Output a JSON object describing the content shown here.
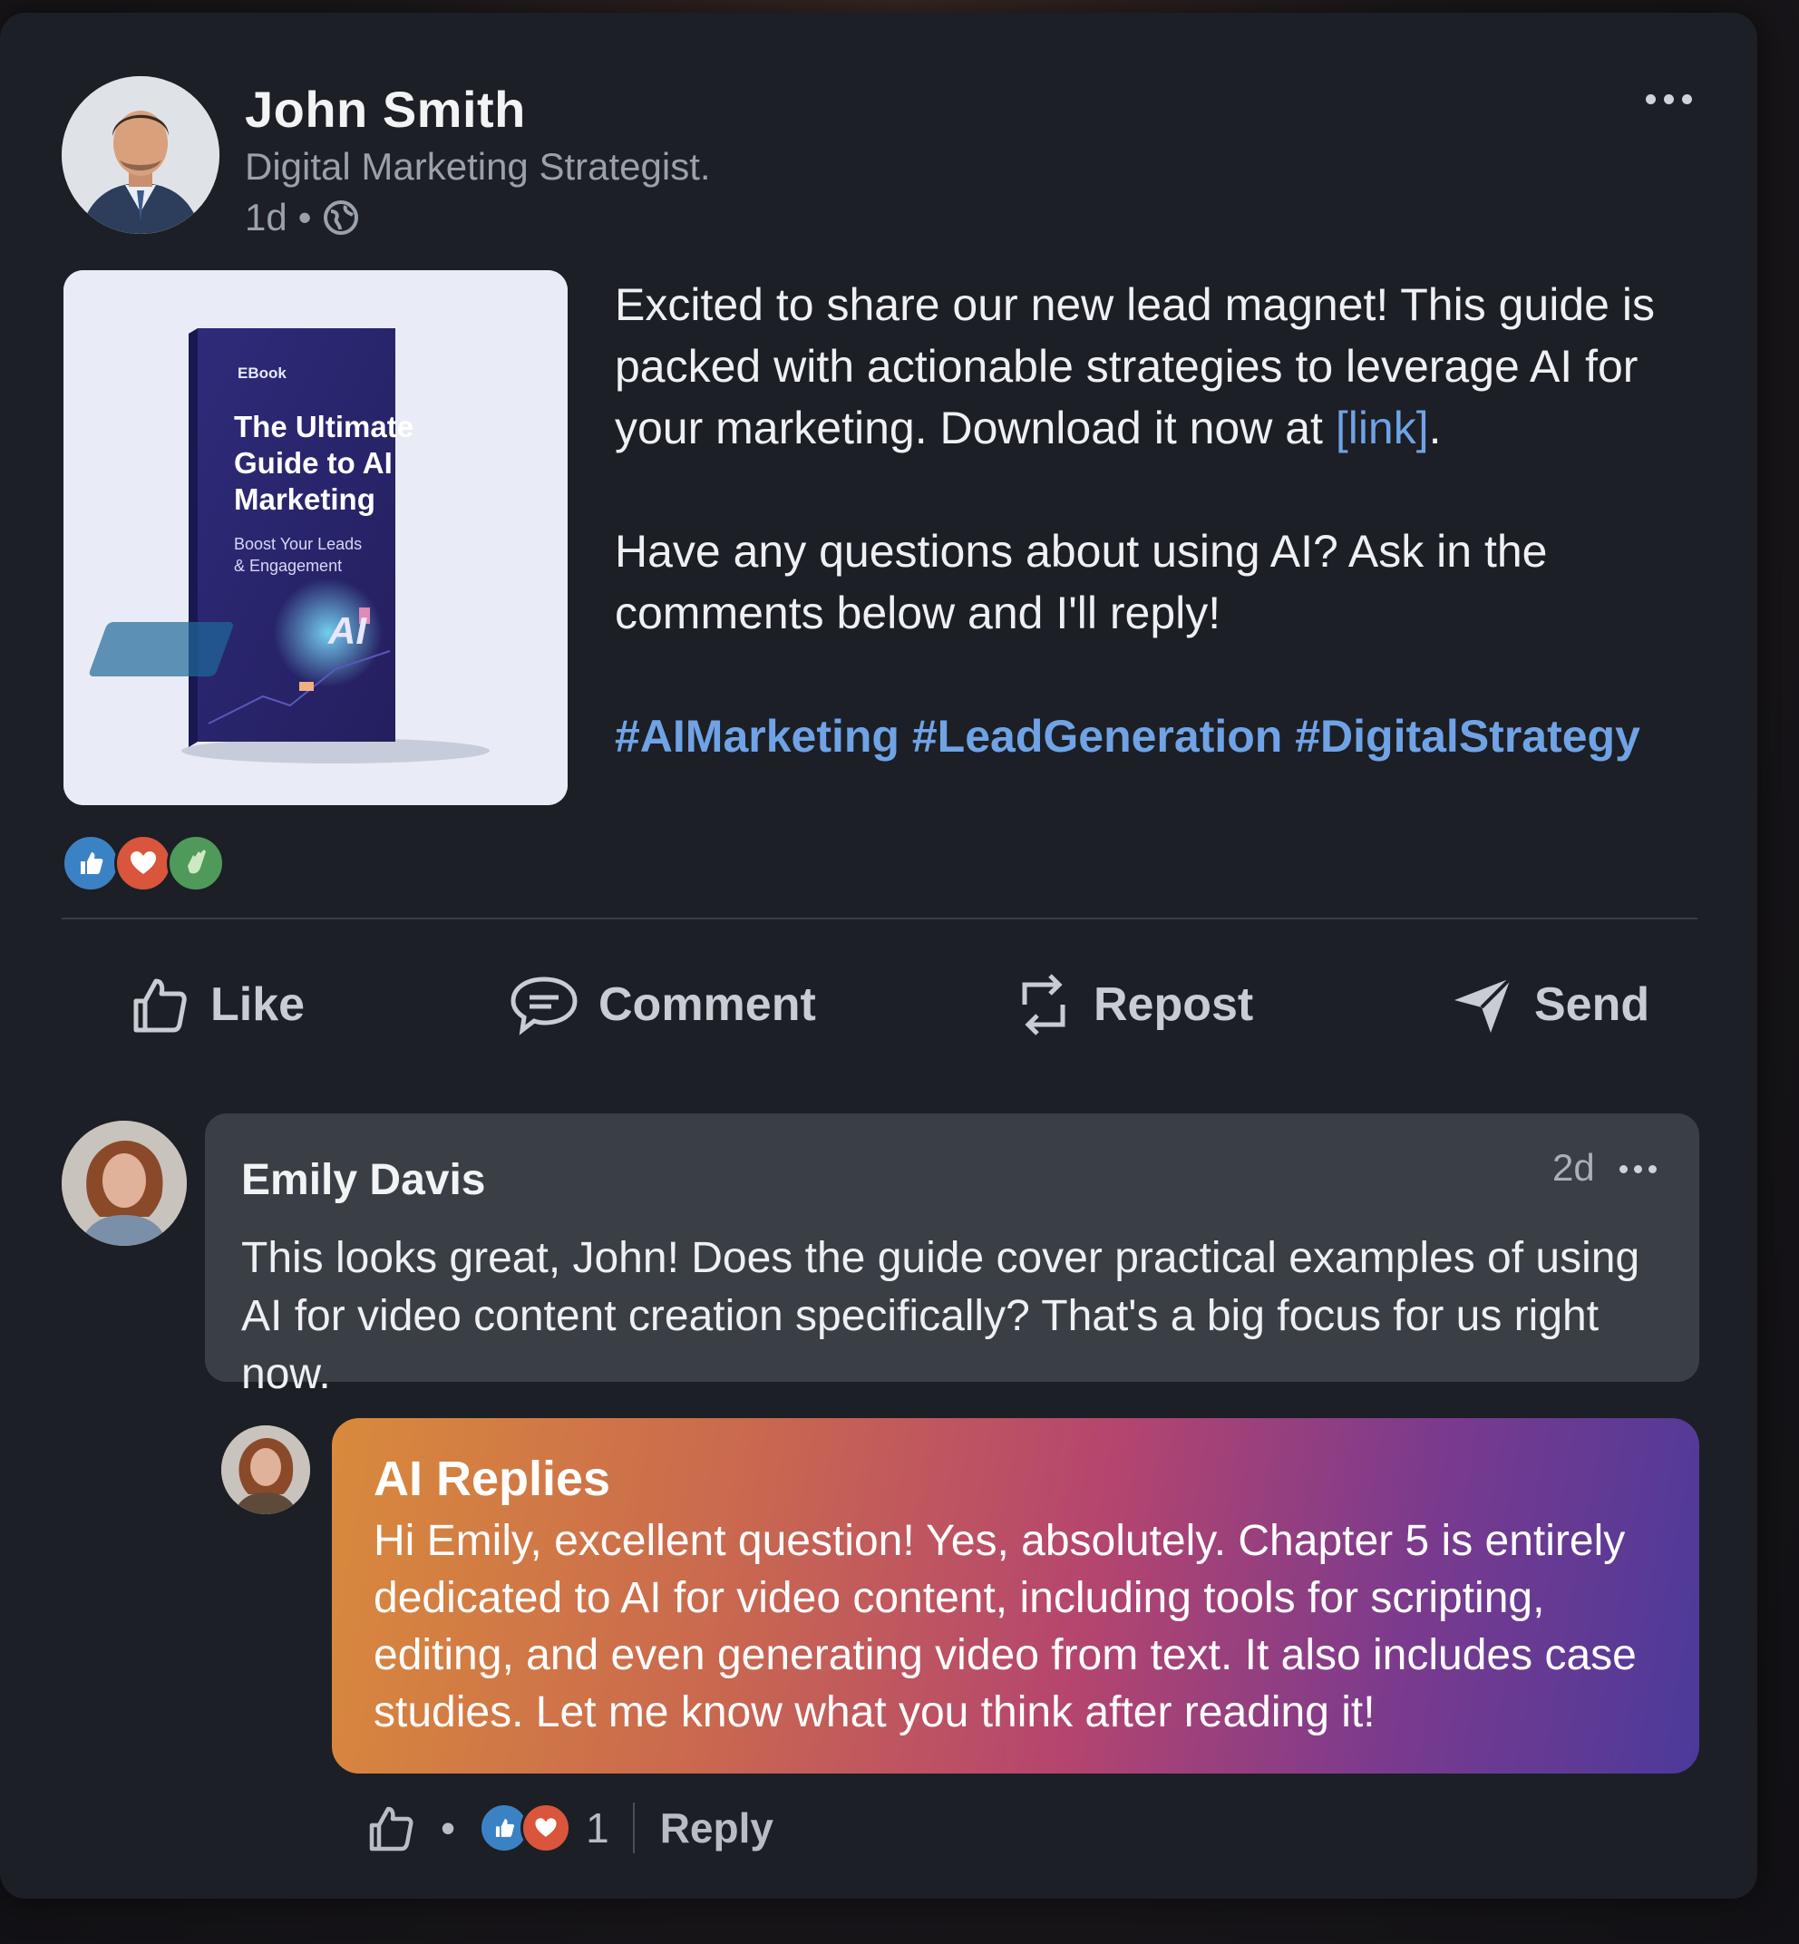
{
  "post": {
    "author_name": "John Smith",
    "author_title": "Digital Marketing Strategist.",
    "time": "1d",
    "meta_separator": "•",
    "ebook": {
      "tag": "EBook",
      "title_lines": [
        "The Ultimate",
        "Guide to AI",
        "Marketing"
      ],
      "subtitle_lines": [
        "Boost Your Leads",
        "& Engagement"
      ],
      "badge": "AI"
    },
    "paragraph1_text": "Excited to share our new lead magnet! This guide is packed with actionable strategies to leverage AI for your marketing. Download it now at ",
    "paragraph1_link": "[link]",
    "paragraph1_end": ".",
    "paragraph2": "Have any questions about using AI? Ask in the comments below and I'll reply!",
    "hashtags": [
      "#AIMarketing",
      "#LeadGeneration",
      "#DigitalStrategy"
    ],
    "reactions": [
      "like-icon",
      "love-icon",
      "clap-icon"
    ]
  },
  "actions": {
    "like": "Like",
    "comment": "Comment",
    "repost": "Repost",
    "send": "Send"
  },
  "comment": {
    "author": "Emily Davis",
    "time": "2d",
    "text": "This looks great, John! Does the guide cover practical examples of using AI for video content creation specifically? That's a big focus for us right now."
  },
  "reply": {
    "author": "AI Replies",
    "text": "Hi Emily, excellent question! Yes, absolutely. Chapter 5 is entirely dedicated to AI for video content, including tools for scripting, editing, and even generating video from text. It also includes case studies. Let me know what you think after reading it!",
    "separator": "•",
    "reaction_count": "1",
    "reply_label": "Reply"
  },
  "colors": {
    "card_bg": "#1c1f25",
    "link": "#6fa3e6",
    "like_blue": "#3b82c4",
    "love_red": "#d9553b",
    "clap_green": "#4f9a5a"
  }
}
